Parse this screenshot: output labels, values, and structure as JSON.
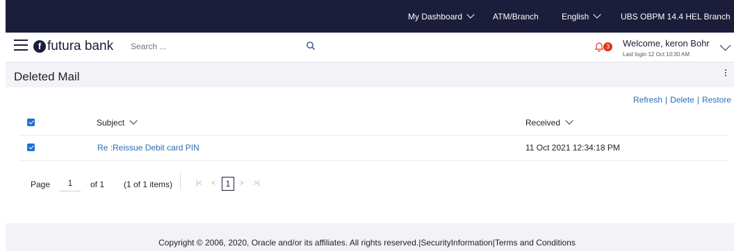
{
  "topbar": {
    "dashboard": "My Dashboard",
    "atm": "ATM/Branch",
    "language": "English",
    "branch": "UBS OBPM 14.4 HEL Branch"
  },
  "header": {
    "logo_text": "futura bank",
    "search_placeholder": "Search ...",
    "notification_count": "3",
    "welcome": "Welcome, keron Bohr",
    "last_login": "Last login 12 Oct 10:30 AM"
  },
  "page": {
    "title": "Deleted Mail"
  },
  "actions": {
    "refresh": "Refresh",
    "delete": "Delete",
    "restore": "Restore",
    "separator": "|"
  },
  "table": {
    "columns": {
      "subject": "Subject",
      "received": "Received"
    },
    "rows": [
      {
        "subject": "Re :Reissue Debit card PIN",
        "received": "11 Oct 2021 12:34:18 PM"
      }
    ]
  },
  "pager": {
    "page_label": "Page",
    "page_value": "1",
    "of_label": "of 1",
    "items_label": "(1 of 1 items)",
    "current": "1",
    "first": "|<",
    "prev": "<",
    "next": ">",
    "last": ">|"
  },
  "footer": {
    "text": "Copyright © 2006, 2020, Oracle and/or its affiliates. All rights reserved.|SecurityInformation|Terms and Conditions"
  },
  "colors": {
    "topbar": "#1b1d3a",
    "link": "#2b6cb0",
    "badge": "#e0311b",
    "checkbox": "#1f6fd1"
  }
}
